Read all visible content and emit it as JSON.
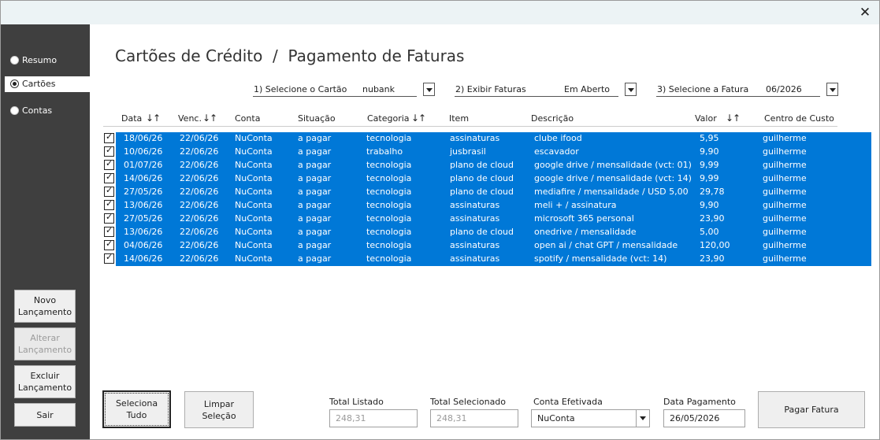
{
  "window": {
    "close_glyph": "✕"
  },
  "sidebar": {
    "nav": [
      {
        "label": "Resumo",
        "selected": false
      },
      {
        "label": "Cartões",
        "selected": true
      },
      {
        "label": "Contas",
        "selected": false
      }
    ],
    "buttons": {
      "novo": "Novo Lançamento",
      "alterar": "Alterar Lançamento",
      "excluir": "Excluir Lançamento",
      "sair": "Sair"
    }
  },
  "page": {
    "title": "Cartões de Crédito  /  Pagamento de Faturas"
  },
  "filters": {
    "card": {
      "label": "1) Selecione o Cartão",
      "value": "nubank"
    },
    "status": {
      "label": "2) Exibir Faturas",
      "value": "Em Aberto"
    },
    "invoice": {
      "label": "3) Selecione a Fatura",
      "value": "06/2026"
    }
  },
  "table": {
    "headers": {
      "data": "Data",
      "venc": "Venc.",
      "conta": "Conta",
      "situacao": "Situação",
      "categoria": "Categoria",
      "item": "Item",
      "descricao": "Descrição",
      "valor": "Valor",
      "centro": "Centro de Custo"
    },
    "sort_glyph": "↓↑",
    "rows": [
      {
        "checked": true,
        "data": "18/06/26",
        "venc": "22/06/26",
        "conta": "NuConta",
        "situacao": "a pagar",
        "categoria": "tecnologia",
        "item": "assinaturas",
        "descricao": "clube ifood",
        "valor": "5,95",
        "centro": "guilherme"
      },
      {
        "checked": true,
        "data": "10/06/26",
        "venc": "22/06/26",
        "conta": "NuConta",
        "situacao": "a pagar",
        "categoria": "trabalho",
        "item": "jusbrasil",
        "descricao": "escavador",
        "valor": "9,90",
        "centro": "guilherme"
      },
      {
        "checked": true,
        "data": "01/07/26",
        "venc": "22/06/26",
        "conta": "NuConta",
        "situacao": "a pagar",
        "categoria": "tecnologia",
        "item": "plano de cloud",
        "descricao": "google drive / mensalidade (vct: 01)",
        "valor": "9,99",
        "centro": "guilherme"
      },
      {
        "checked": true,
        "data": "14/06/26",
        "venc": "22/06/26",
        "conta": "NuConta",
        "situacao": "a pagar",
        "categoria": "tecnologia",
        "item": "plano de cloud",
        "descricao": "google drive / mensalidade (vct: 14)",
        "valor": "9,99",
        "centro": "guilherme"
      },
      {
        "checked": true,
        "data": "27/05/26",
        "venc": "22/06/26",
        "conta": "NuConta",
        "situacao": "a pagar",
        "categoria": "tecnologia",
        "item": "plano de cloud",
        "descricao": "mediafire / mensalidade / USD 5,00",
        "valor": "29,78",
        "centro": "guilherme"
      },
      {
        "checked": true,
        "data": "13/06/26",
        "venc": "22/06/26",
        "conta": "NuConta",
        "situacao": "a pagar",
        "categoria": "tecnologia",
        "item": "assinaturas",
        "descricao": "meli + / assinatura",
        "valor": "9,90",
        "centro": "guilherme"
      },
      {
        "checked": true,
        "data": "27/05/26",
        "venc": "22/06/26",
        "conta": "NuConta",
        "situacao": "a pagar",
        "categoria": "tecnologia",
        "item": "assinaturas",
        "descricao": "microsoft 365 personal",
        "valor": "23,90",
        "centro": "guilherme"
      },
      {
        "checked": true,
        "data": "13/06/26",
        "venc": "22/06/26",
        "conta": "NuConta",
        "situacao": "a pagar",
        "categoria": "tecnologia",
        "item": "plano de cloud",
        "descricao": "onedrive / mensalidade",
        "valor": "5,00",
        "centro": "guilherme"
      },
      {
        "checked": true,
        "data": "04/06/26",
        "venc": "22/06/26",
        "conta": "NuConta",
        "situacao": "a pagar",
        "categoria": "tecnologia",
        "item": "assinaturas",
        "descricao": "open ai / chat GPT / mensalidade",
        "valor": "120,00",
        "centro": "guilherme"
      },
      {
        "checked": true,
        "data": "14/06/26",
        "venc": "22/06/26",
        "conta": "NuConta",
        "situacao": "a pagar",
        "categoria": "tecnologia",
        "item": "assinaturas",
        "descricao": "spotify / mensalidade (vct: 14)",
        "valor": "23,90",
        "centro": "guilherme"
      }
    ]
  },
  "footer": {
    "select_all": "Seleciona Tudo",
    "clear": "Limpar Seleção",
    "total_listado": {
      "label": "Total Listado",
      "value": "248,31"
    },
    "total_selecionado": {
      "label": "Total Selecionado",
      "value": "248,31"
    },
    "conta_efetivada": {
      "label": "Conta Efetivada",
      "value": "NuConta"
    },
    "data_pagamento": {
      "label": "Data Pagamento",
      "value": "26/05/2026"
    },
    "pay_button": "Pagar Fatura"
  },
  "colors": {
    "sidebar_bg": "#3f3f3f",
    "selection_blue": "#0078d7",
    "titlebar": "#ecf3f5"
  }
}
